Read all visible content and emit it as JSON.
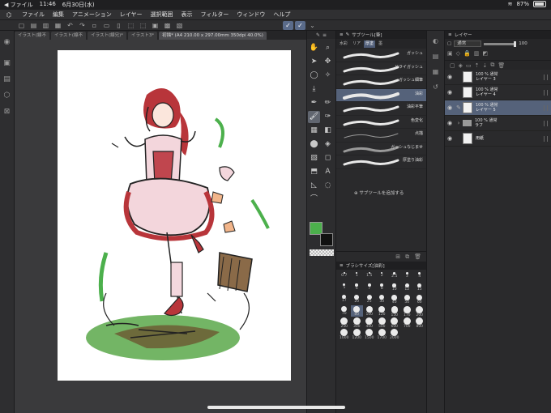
{
  "status": {
    "back": "◀ ファイル",
    "time": "11:46",
    "date": "6月30日(水)",
    "battery": "87%"
  },
  "menu": [
    "ファイル",
    "編集",
    "アニメーション",
    "レイヤー",
    "選択範囲",
    "表示",
    "フィルター",
    "ウィンドウ",
    "ヘルプ"
  ],
  "tabs": [
    {
      "label": "イラスト(線不"
    },
    {
      "label": "イラスト(線不"
    },
    {
      "label": "イラスト(線兄)*"
    },
    {
      "label": "イラスト3*"
    },
    {
      "label": "初描* (A4 210.00 x 297.00mm 350dpi 40.0%)"
    }
  ],
  "subtool": {
    "title": "サブツール[筆]",
    "tabs": [
      "水彩",
      "リア",
      "厚塗",
      "墨"
    ],
    "brushes": [
      "ガッシュ",
      "ドライガッシュ",
      "ガッシュ細筆",
      "油彩",
      "油彩平筆",
      "色変化",
      "点描",
      "ガッシュなじませ",
      "厚塗り油彩"
    ],
    "selected_index": 3,
    "add_label": "サブツールを追加する"
  },
  "brushsize": {
    "title": "ブラシサイズ[油彩]",
    "sizes": [
      "0.7",
      "1",
      "1.5",
      "2",
      "2.5",
      "3",
      "4",
      "5",
      "6",
      "7",
      "8",
      "10",
      "12",
      "15",
      "17",
      "20",
      "25",
      "30",
      "40",
      "50",
      "60",
      "70",
      "80",
      "100",
      "120",
      "150",
      "170",
      "200",
      "250",
      "300",
      "400",
      "500",
      "600",
      "700",
      "800",
      "1000",
      "1200",
      "1500",
      "1700",
      "2000"
    ],
    "selected": "80"
  },
  "layers": {
    "title": "レイヤー",
    "blend_mode": "通常",
    "opacity": "100",
    "items": [
      {
        "opacity": "100 %",
        "mode": "通常",
        "name": "レイヤー 3",
        "active": false
      },
      {
        "opacity": "100 %",
        "mode": "通常",
        "name": "レイヤー 4",
        "active": false
      },
      {
        "opacity": "100 %",
        "mode": "通常",
        "name": "レイヤー 5",
        "active": true
      },
      {
        "opacity": "100 %",
        "mode": "通常",
        "name": "ラフ",
        "active": false,
        "folder": true
      },
      {
        "opacity": "",
        "mode": "",
        "name": "用紙",
        "active": false
      }
    ]
  },
  "colors": {
    "main": "#4cb04c",
    "sub": "#111111",
    "accent": "#55627a"
  }
}
